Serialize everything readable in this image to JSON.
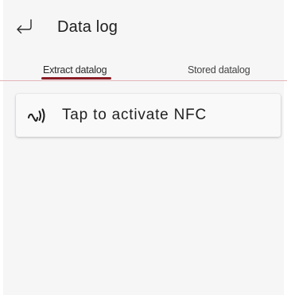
{
  "header": {
    "back_icon": "back-arrow-icon",
    "title": "Data log"
  },
  "tabs": [
    {
      "label": "Extract datalog",
      "selected": true
    },
    {
      "label": "Stored datalog",
      "selected": false
    }
  ],
  "nfc_card": {
    "icon": "nfc-icon",
    "label": "Tap to activate NFC"
  },
  "colors": {
    "accent": "#8a1c24",
    "divider": "#e3b4b7",
    "background": "#f6f6f7",
    "card": "#f9f9f9"
  }
}
